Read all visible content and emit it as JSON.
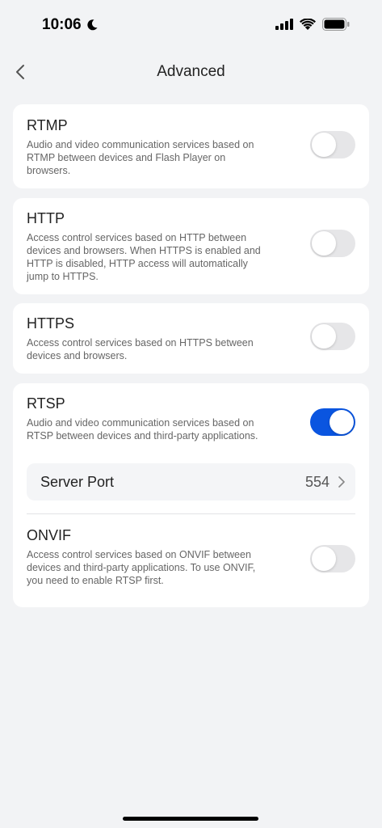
{
  "status_bar": {
    "time": "10:06",
    "moon_icon": "moon-icon",
    "signal_icon": "signal-icon",
    "wifi_icon": "wifi-icon",
    "battery_icon": "battery-icon"
  },
  "nav": {
    "back_icon": "chevron-left-icon",
    "title": "Advanced"
  },
  "services": [
    {
      "title": "RTMP",
      "description": "Audio and video communication services based on RTMP between devices and Flash Player on browsers.",
      "enabled": false
    },
    {
      "title": "HTTP",
      "description": "Access control services based on HTTP between devices and browsers. When HTTPS is enabled and HTTP is disabled, HTTP access will automatically jump to HTTPS.",
      "enabled": false
    },
    {
      "title": "HTTPS",
      "description": "Access control services based on HTTPS between devices and browsers.",
      "enabled": false
    },
    {
      "title": "RTSP",
      "description": "Audio and video communication services based on RTSP between devices and third-party applications.",
      "enabled": true,
      "server_port": {
        "label": "Server Port",
        "value": "554"
      }
    },
    {
      "title": "ONVIF",
      "description": "Access control services based on ONVIF between devices and third-party applications. To use ONVIF, you need to enable RTSP first.",
      "enabled": false
    }
  ],
  "colors": {
    "accent": "#0a55e0",
    "background": "#f2f3f5",
    "card": "#ffffff"
  }
}
